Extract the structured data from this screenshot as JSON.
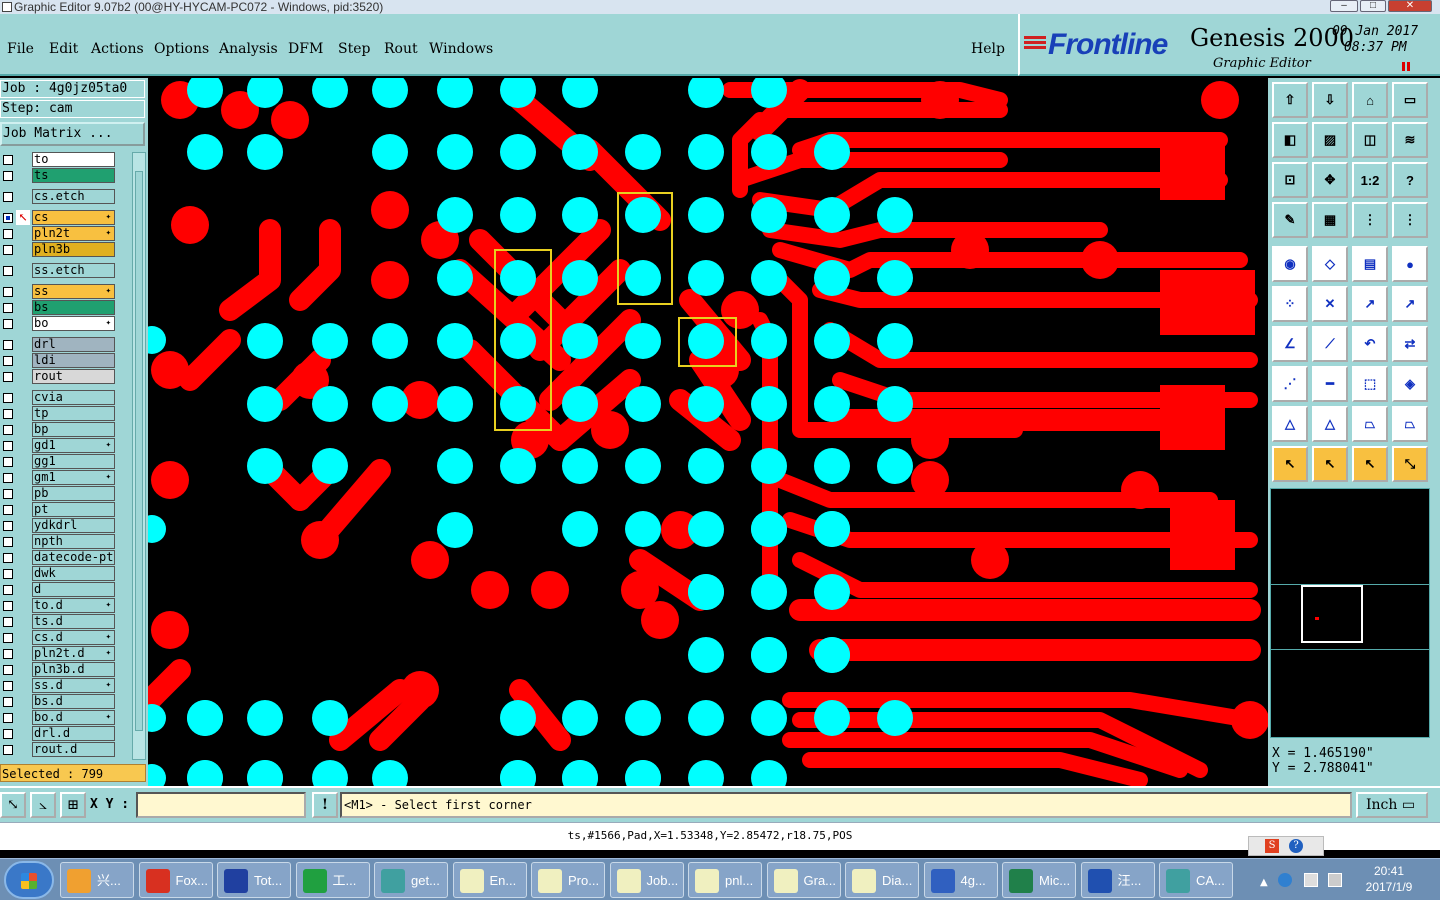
{
  "window": {
    "title": "Graphic Editor 9.07b2 (00@HY-HYCAM-PC072 - Windows, pid:3520)"
  },
  "menu": [
    {
      "label": "File"
    },
    {
      "label": "Edit"
    },
    {
      "label": "Actions"
    },
    {
      "label": "Options"
    },
    {
      "label": "Analysis"
    },
    {
      "label": "DFM"
    },
    {
      "label": "Step"
    },
    {
      "label": "Rout"
    },
    {
      "label": "Windows"
    },
    {
      "label": "Help"
    }
  ],
  "brand": {
    "logo": "Frontline",
    "product": "Genesis 2000",
    "subtitle": "Graphic Editor",
    "date": "09 Jan 2017",
    "time": "08:37 PM"
  },
  "job": {
    "job_label": "Job : 4g0jz05ta0",
    "step_label": "Step: cam",
    "matrix_button": "Job Matrix ..."
  },
  "layers": [
    {
      "name": "to",
      "color": "#ffffff",
      "mark": ""
    },
    {
      "name": "ts",
      "color": "#20a070",
      "mark": ""
    },
    {
      "name": "cs.etch",
      "color": "#9fd6d6",
      "mark": ""
    },
    {
      "name": "cs",
      "color": "#f8c040",
      "mark": "✦"
    },
    {
      "name": "pln2t",
      "color": "#f8c040",
      "mark": "✦"
    },
    {
      "name": "pln3b",
      "color": "#e0b020",
      "mark": ""
    },
    {
      "name": "ss.etch",
      "color": "#9fd6d6",
      "mark": ""
    },
    {
      "name": "ss",
      "color": "#f8c040",
      "mark": "✦"
    },
    {
      "name": "bs",
      "color": "#20a070",
      "mark": ""
    },
    {
      "name": "bo",
      "color": "#ffffff",
      "mark": "✦"
    },
    {
      "name": "drl",
      "color": "#a0b4c0",
      "mark": ""
    },
    {
      "name": "ldi",
      "color": "#a0b4c0",
      "mark": ""
    },
    {
      "name": "rout",
      "color": "#d8d8d8",
      "mark": ""
    },
    {
      "name": "cvia",
      "color": "#9fd6d6",
      "mark": ""
    },
    {
      "name": "tp",
      "color": "#9fd6d6",
      "mark": ""
    },
    {
      "name": "bp",
      "color": "#9fd6d6",
      "mark": ""
    },
    {
      "name": "gd1",
      "color": "#9fd6d6",
      "mark": "✦"
    },
    {
      "name": "gg1",
      "color": "#9fd6d6",
      "mark": ""
    },
    {
      "name": "gm1",
      "color": "#9fd6d6",
      "mark": "✦"
    },
    {
      "name": "pb",
      "color": "#9fd6d6",
      "mark": ""
    },
    {
      "name": "pt",
      "color": "#9fd6d6",
      "mark": ""
    },
    {
      "name": "ydkdrl",
      "color": "#9fd6d6",
      "mark": ""
    },
    {
      "name": "npth",
      "color": "#9fd6d6",
      "mark": ""
    },
    {
      "name": "datecode-pt",
      "color": "#9fd6d6",
      "mark": ""
    },
    {
      "name": "dwk",
      "color": "#9fd6d6",
      "mark": ""
    },
    {
      "name": "d",
      "color": "#9fd6d6",
      "mark": ""
    },
    {
      "name": "to.d",
      "color": "#9fd6d6",
      "mark": "✦"
    },
    {
      "name": "ts.d",
      "color": "#9fd6d6",
      "mark": ""
    },
    {
      "name": "cs.d",
      "color": "#9fd6d6",
      "mark": "✦"
    },
    {
      "name": "pln2t.d",
      "color": "#9fd6d6",
      "mark": "✦"
    },
    {
      "name": "pln3b.d",
      "color": "#9fd6d6",
      "mark": ""
    },
    {
      "name": "ss.d",
      "color": "#9fd6d6",
      "mark": "✦"
    },
    {
      "name": "bs.d",
      "color": "#9fd6d6",
      "mark": ""
    },
    {
      "name": "bo.d",
      "color": "#9fd6d6",
      "mark": "✦"
    },
    {
      "name": "drl.d",
      "color": "#9fd6d6",
      "mark": ""
    },
    {
      "name": "rout.d",
      "color": "#9fd6d6",
      "mark": ""
    }
  ],
  "selected_label": "Selected : 799",
  "tools": [
    "home-up-icon",
    "home-down-icon",
    "home-icon",
    "window-icon",
    "pan-left-icon",
    "pan-right-icon",
    "zoom-in-icon",
    "zoom-s-icon",
    "fit-icon",
    "zoom-center-icon",
    "zoom-1-2-icon",
    "help-icon",
    "measure-icon",
    "grid-icon",
    "snap-icon",
    "layers-icon",
    "pad-icon",
    "polygon-icon",
    "ruler-icon",
    "circle-icon",
    "connect-icon",
    "delete-icon",
    "move-icon",
    "copy-icon",
    "line-icon",
    "slash-icon",
    "undo-icon",
    "flip-icon",
    "pad-move-icon",
    "line-move-icon",
    "resize-icon",
    "group-icon",
    "arc-icon",
    "triangle-icon",
    "trapezoid-icon",
    "trapezoid-up-icon",
    "select-icon",
    "select-box-icon",
    "select-lasso-icon",
    "select-net-icon"
  ],
  "coords": {
    "x": "X = 1.465190\"",
    "y": "Y = 2.788041\""
  },
  "bottom": {
    "xy_label": "X Y :",
    "xy_value": "",
    "prompt": "<M1> - Select first corner",
    "unit": "Inch"
  },
  "status": "ts,#1566,Pad,X=1.53348,Y=2.85472,r18.75,POS",
  "taskbar": {
    "items": [
      {
        "label": "兴...",
        "color": "#f0a030"
      },
      {
        "label": "Fox...",
        "color": "#d83020"
      },
      {
        "label": "Tot...",
        "color": "#2040a0"
      },
      {
        "label": "工...",
        "color": "#20a040"
      },
      {
        "label": "get...",
        "color": "#40a0a0"
      },
      {
        "label": "En...",
        "color": "#f0f0c0"
      },
      {
        "label": "Pro...",
        "color": "#f0f0c0"
      },
      {
        "label": "Job...",
        "color": "#f0f0c0"
      },
      {
        "label": "pnl...",
        "color": "#f0f0c0"
      },
      {
        "label": "Gra...",
        "color": "#f0f0c0"
      },
      {
        "label": "Dia...",
        "color": "#f0f0c0"
      },
      {
        "label": "4g...",
        "color": "#3060c0"
      },
      {
        "label": "Mic...",
        "color": "#20804a"
      },
      {
        "label": "汪...",
        "color": "#2050b0"
      },
      {
        "label": "CA...",
        "color": "#40a0a0"
      }
    ],
    "time": "20:41",
    "date": "2017/1/9"
  },
  "colors": {
    "copper": "#ff0000",
    "pad": "#00ffff",
    "highlight": "#e8d020",
    "panel": "#9fd6d6"
  }
}
